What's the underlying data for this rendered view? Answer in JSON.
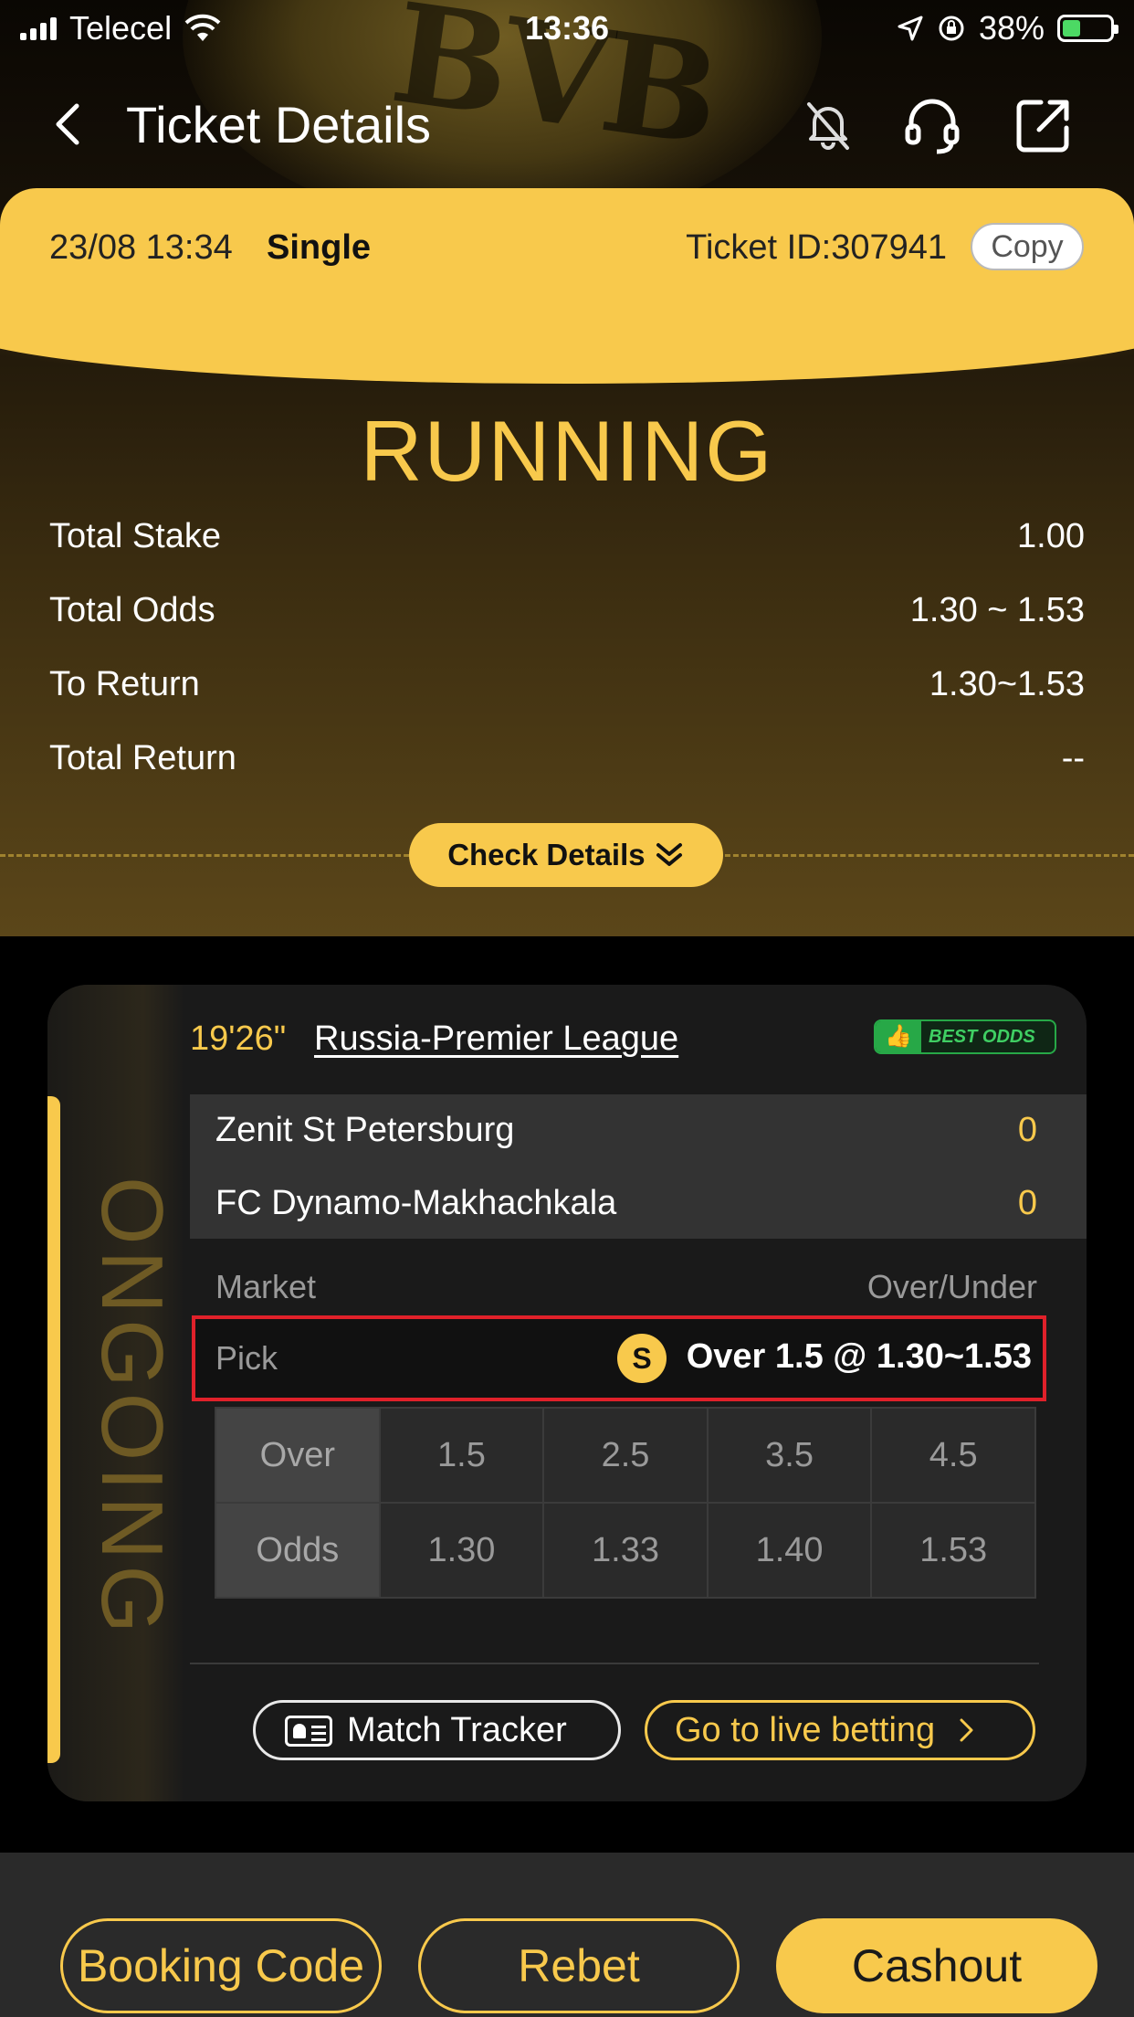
{
  "status_bar": {
    "carrier": "Telecel",
    "time": "13:36",
    "battery": "38%"
  },
  "nav": {
    "title": "Ticket Details",
    "icons": [
      "back-icon",
      "bell-off-icon",
      "headset-icon",
      "share-icon"
    ]
  },
  "ticket": {
    "date": "23/08 13:34",
    "type": "Single",
    "id_label": "Ticket ID:307941",
    "copy_label": "Copy",
    "status": "RUNNING"
  },
  "summary": [
    {
      "label": "Total Stake",
      "value": "1.00"
    },
    {
      "label": "Total Odds",
      "value": "1.30 ~ 1.53"
    },
    {
      "label": "To Return",
      "value": "1.30~1.53"
    },
    {
      "label": "Total Return",
      "value": "--"
    }
  ],
  "check_details_label": "Check Details",
  "match": {
    "status_vertical": "ONGOING",
    "time": "19'26\"",
    "league": "Russia-Premier League",
    "best_odds_label": "BEST ODDS",
    "teams": [
      {
        "name": "Zenit St Petersburg",
        "score": "0"
      },
      {
        "name": "FC Dynamo-Makhachkala",
        "score": "0"
      }
    ],
    "market_label": "Market",
    "market_value": "Over/Under",
    "pick_label": "Pick",
    "pick_badge": "S",
    "pick_value": "Over 1.5 @ 1.30~1.53",
    "odds_table": {
      "row1": [
        "Over",
        "1.5",
        "2.5",
        "3.5",
        "4.5"
      ],
      "row2": [
        "Odds",
        "1.30",
        "1.33",
        "1.40",
        "1.53"
      ]
    },
    "tracker_label": "Match Tracker",
    "live_label": "Go to live betting"
  },
  "bottom": {
    "booking_label": "Booking Code",
    "rebet_label": "Rebet",
    "cashout_label": "Cashout"
  },
  "colors": {
    "accent": "#f8c94c",
    "highlight_border": "#e0212a",
    "best_odds_green": "#27a847"
  }
}
